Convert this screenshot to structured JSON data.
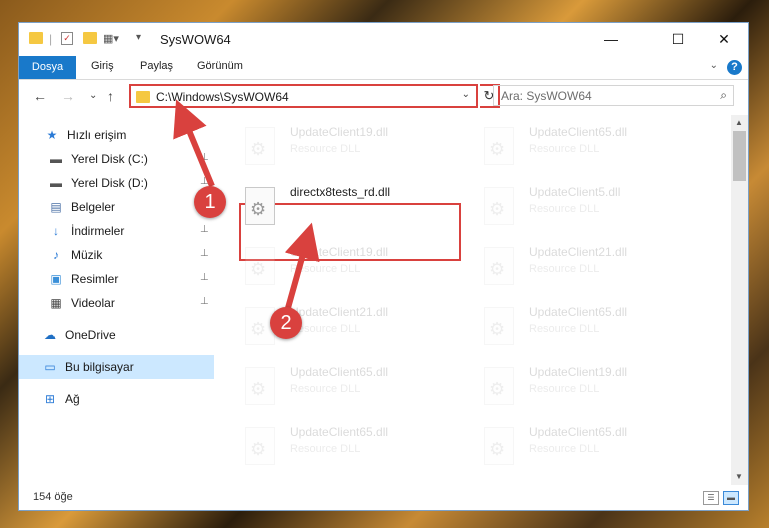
{
  "window": {
    "title": "SysWOW64",
    "controls": {
      "minimize": "—",
      "maximize": "☐",
      "close": "✕"
    }
  },
  "ribbon": {
    "tabs": [
      "Dosya",
      "Giriş",
      "Paylaş",
      "Görünüm"
    ],
    "help": "?",
    "expand": "⌄"
  },
  "navigation": {
    "back": "←",
    "forward": "→",
    "recent": "⌄",
    "up": "↑",
    "address": "C:\\Windows\\SysWOW64",
    "address_dropdown": "⌄",
    "refresh": "↻",
    "search_placeholder": "Ara: SysWOW64",
    "search_icon": "⌕"
  },
  "sidebar": {
    "items": [
      {
        "label": "Hızlı erişim",
        "icon": "star-icon",
        "glyph": "★",
        "color": "#2b7bd6",
        "pinned": false
      },
      {
        "label": "Yerel Disk (C:)",
        "icon": "drive-icon",
        "glyph": "▬",
        "color": "#555555",
        "pinned": true
      },
      {
        "label": "Yerel Disk (D:)",
        "icon": "drive-icon",
        "glyph": "▬",
        "color": "#555555",
        "pinned": true
      },
      {
        "label": "Belgeler",
        "icon": "documents-icon",
        "glyph": "▤",
        "color": "#4a6fa5",
        "pinned": true
      },
      {
        "label": "İndirmeler",
        "icon": "download-icon",
        "glyph": "↓",
        "color": "#2b7bd6",
        "pinned": true
      },
      {
        "label": "Müzik",
        "icon": "music-icon",
        "glyph": "♪",
        "color": "#2b7bd6",
        "pinned": true
      },
      {
        "label": "Resimler",
        "icon": "pictures-icon",
        "glyph": "▣",
        "color": "#3a8fd8",
        "pinned": true
      },
      {
        "label": "Videolar",
        "icon": "video-icon",
        "glyph": "▦",
        "color": "#444444",
        "pinned": true
      },
      {
        "label": "OneDrive",
        "icon": "cloud-icon",
        "glyph": "☁",
        "color": "#1f6fc4",
        "pinned": false
      },
      {
        "label": "Bu bilgisayar",
        "icon": "computer-icon",
        "glyph": "▭",
        "color": "#2b7bd6",
        "pinned": false
      },
      {
        "label": "Ağ",
        "icon": "network-icon",
        "glyph": "⊞",
        "color": "#2b7bd6",
        "pinned": false
      }
    ],
    "pin_glyph": "📌"
  },
  "files": [
    {
      "name": "UpdateClient19.dll",
      "type": "Resource DLL",
      "faded": true
    },
    {
      "name": "UpdateClient65.dll",
      "type": "Resource DLL",
      "faded": true
    },
    {
      "name": "directx8tests_rd.dll",
      "type": "",
      "faded": false
    },
    {
      "name": "UpdateClient5.dll",
      "type": "Resource DLL",
      "faded": true
    },
    {
      "name": "UpdateClient19.dll",
      "type": "Resource DLL",
      "faded": true
    },
    {
      "name": "UpdateClient21.dll",
      "type": "Resource DLL",
      "faded": true
    },
    {
      "name": "UpdateClient21.dll",
      "type": "Resource DLL",
      "faded": true
    },
    {
      "name": "UpdateClient65.dll",
      "type": "Resource DLL",
      "faded": true
    },
    {
      "name": "UpdateClient65.dll",
      "type": "Resource DLL",
      "faded": true
    },
    {
      "name": "UpdateClient19.dll",
      "type": "Resource DLL",
      "faded": true
    },
    {
      "name": "UpdateClient65.dll",
      "type": "Resource DLL",
      "faded": true
    },
    {
      "name": "UpdateClient65.dll",
      "type": "Resource DLL",
      "faded": true
    }
  ],
  "callouts": [
    "1",
    "2"
  ],
  "status": {
    "count": "154 öğe"
  },
  "colors": {
    "accent": "#1979ca",
    "highlight": "#d9413e",
    "selected": "#cce8ff"
  }
}
